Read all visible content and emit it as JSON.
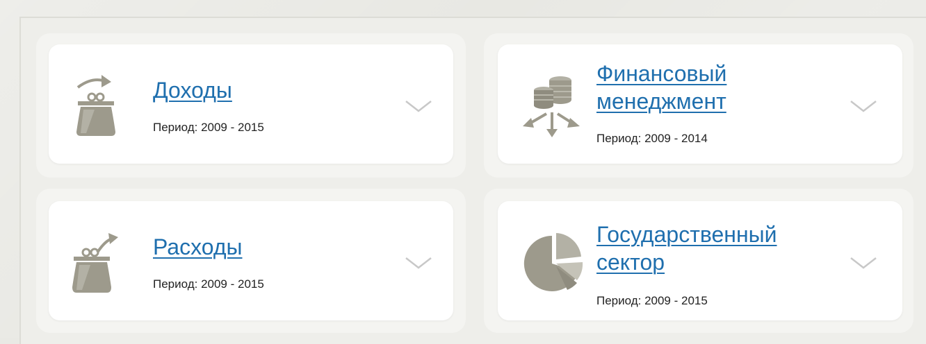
{
  "cards": [
    {
      "title_lines": [
        "Доходы"
      ],
      "period": "Период: 2009 - 2015",
      "icon": "purse-in-icon"
    },
    {
      "title_lines": [
        "Финансовый",
        "менеджмент"
      ],
      "period": "Период: 2009 - 2014",
      "icon": "coins-distribution-icon"
    },
    {
      "title_lines": [
        "Расходы"
      ],
      "period": "Период: 2009 - 2015",
      "icon": "purse-out-icon"
    },
    {
      "title_lines": [
        "Государственный",
        "сектор"
      ],
      "period": "Период: 2009 - 2015",
      "icon": "pie-chart-icon"
    }
  ],
  "colors": {
    "link": "#1f6fae",
    "icon": "#9d9a8c",
    "chevron": "#c8c8c8"
  }
}
